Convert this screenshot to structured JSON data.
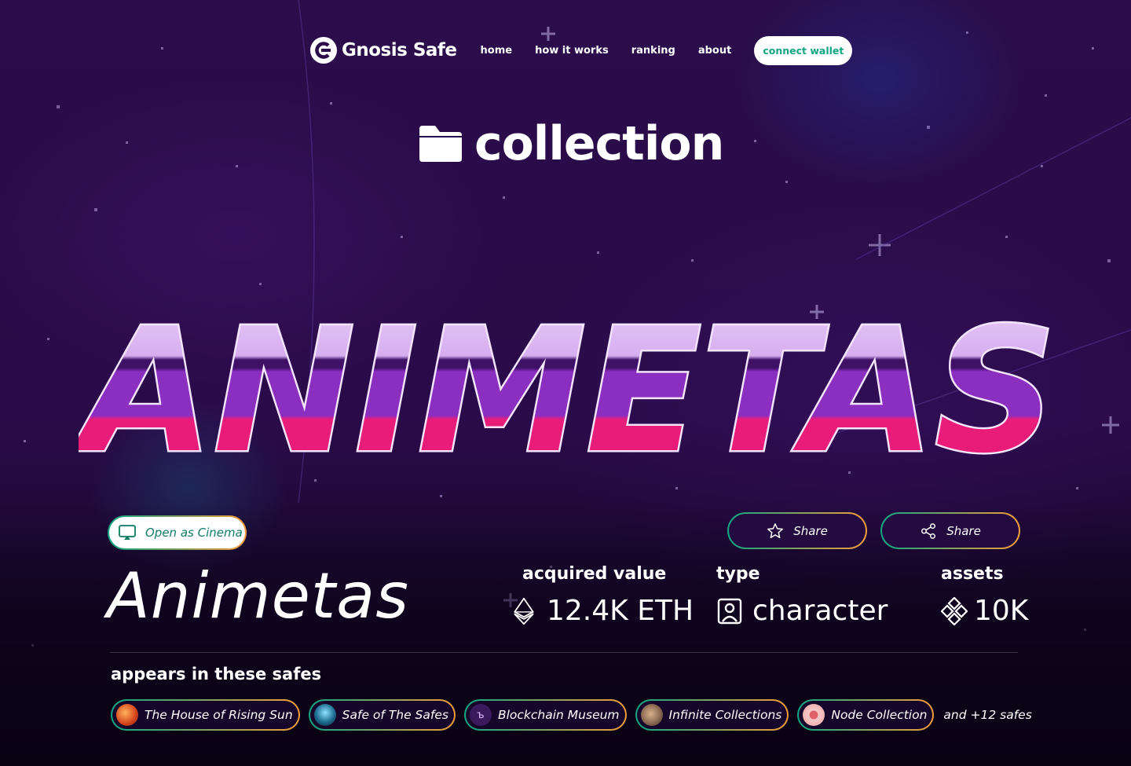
{
  "nav": {
    "logo_text": "Gnosis Safe",
    "links": [
      "home",
      "how it works",
      "ranking",
      "about"
    ],
    "connect_label": "connect wallet",
    "accent_color": "#12a584"
  },
  "section": {
    "title": "collection",
    "icon": "folder-icon"
  },
  "hero": {
    "title": "ANIMETAS",
    "gradient_colors": [
      "#e8c8f4",
      "#8a2fc0",
      "#ea1c7a"
    ]
  },
  "actions": {
    "cinema_label": "Open as Cinema",
    "favorite_label": "Share",
    "share_label": "Share"
  },
  "collection": {
    "name": "Animetas"
  },
  "stats": {
    "acquired_label": "acquired value",
    "acquired_value": "12.4K ETH",
    "acquired_icon": "ethereum-icon",
    "type_label": "type",
    "type_value": "character",
    "type_icon": "portrait-icon",
    "assets_label": "assets",
    "assets_value": "10K",
    "assets_icon": "diamond-grid-icon"
  },
  "safes": {
    "heading": "appears in these safes",
    "items": [
      {
        "label": "The House of Rising Sun",
        "avatar_color": "#e0582a"
      },
      {
        "label": "Safe of The Safes",
        "avatar_color": "#1d6c8f"
      },
      {
        "label": "Blockchain Museum",
        "avatar_color": "#3a1a5c",
        "glyph": "ъ"
      },
      {
        "label": "Infinite Collections",
        "avatar_color": "#8a6a52"
      },
      {
        "label": "Node Collection",
        "avatar_color": "#f0b4b4"
      }
    ],
    "more": "and +12 safes"
  }
}
